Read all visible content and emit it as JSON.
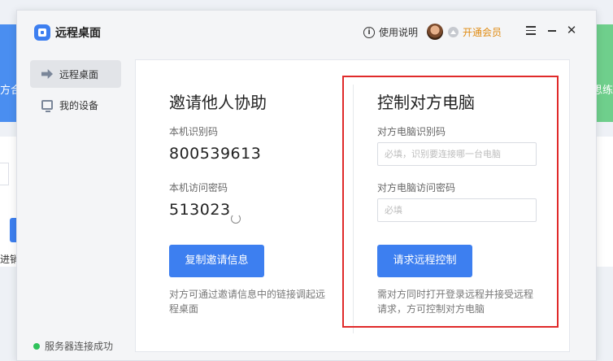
{
  "background_app": {
    "left_text": "方合",
    "right_text": "思练",
    "lower_left_text": "进销"
  },
  "window": {
    "title": "远程桌面",
    "help_label": "使用说明",
    "vip_label": "开通会员",
    "menu_icon": "hamburger-menu-icon",
    "minimize_icon": "minimize-icon",
    "close_glyph": "✕"
  },
  "sidebar": {
    "items": [
      {
        "label": "远程桌面",
        "icon": "remote-desktop-icon",
        "active": true
      },
      {
        "label": "我的设备",
        "icon": "monitor-icon",
        "active": false
      }
    ],
    "status": "服务器连接成功"
  },
  "invite": {
    "title": "邀请他人协助",
    "id_label": "本机识别码",
    "id_value": "800539613",
    "password_label": "本机访问密码",
    "password_value": "513023",
    "copy_button": "复制邀请信息",
    "note": "对方可通过邀请信息中的链接调起远程桌面"
  },
  "control": {
    "title": "控制对方电脑",
    "id_label": "对方电脑识别码",
    "id_placeholder": "必填，识别要连接哪一台电脑",
    "password_label": "对方电脑访问密码",
    "password_placeholder": "必填",
    "request_button": "请求远程控制",
    "note": "需对方同时打开登录远程并接受远程请求，方可控制对方电脑"
  },
  "colors": {
    "accent": "#3d7ff0",
    "vip": "#e08b12",
    "status_ok": "#2fc25b",
    "highlight_border": "#e02a2a"
  }
}
